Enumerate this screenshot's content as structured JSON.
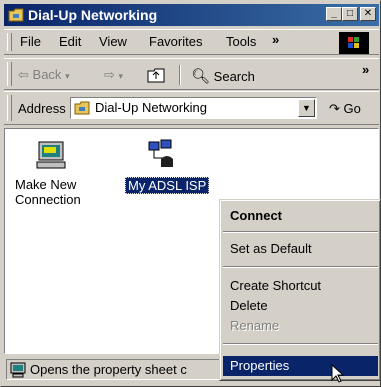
{
  "window": {
    "title": "Dial-Up Networking"
  },
  "menubar": {
    "items": [
      "File",
      "Edit",
      "View",
      "Favorites",
      "Tools"
    ],
    "more": "»"
  },
  "toolbar": {
    "back_label": "Back",
    "search_label": "Search",
    "more": "»"
  },
  "address": {
    "label": "Address",
    "value": "Dial-Up Networking",
    "go_label": "Go"
  },
  "icons": [
    {
      "label_line1": "Make New",
      "label_line2": "Connection"
    },
    {
      "label": "My ADSL ISP"
    }
  ],
  "context_menu": {
    "items": [
      "Connect",
      "Set as Default",
      "Create Shortcut",
      "Delete",
      "Rename",
      "Properties"
    ],
    "default_item": "Connect",
    "disabled_item": "Rename",
    "highlighted_item": "Properties"
  },
  "statusbar": {
    "text": "Opens the property sheet c"
  },
  "colors": {
    "title_bar": "#0a246a",
    "selection": "#0a246a",
    "face": "#d4d0c8"
  }
}
